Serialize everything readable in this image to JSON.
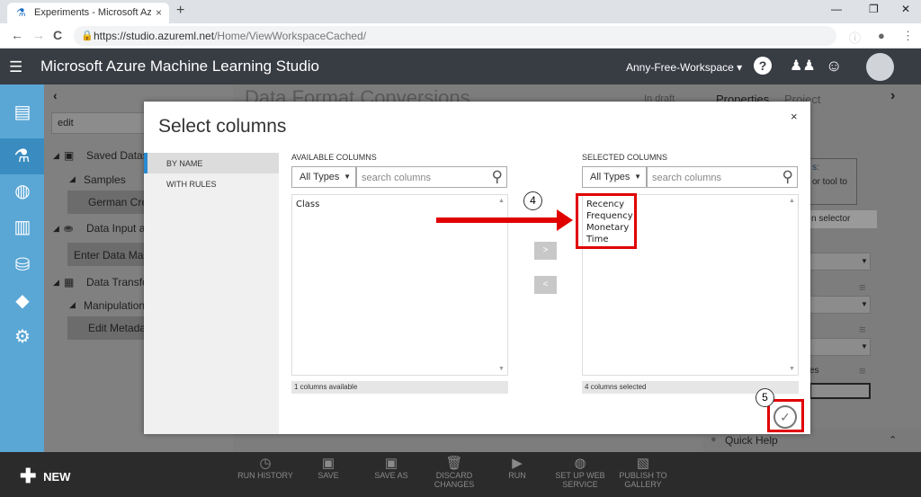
{
  "browser": {
    "tab_title": "Experiments - Microsoft Azure",
    "tab_close": "×",
    "new_tab": "+",
    "url_host": "https://studio.azureml.net",
    "url_path": "/Home/ViewWorkspaceCached/",
    "back": "←",
    "forward": "→",
    "reload": "C",
    "min": "—",
    "max": "❐",
    "close": "✕"
  },
  "app": {
    "title": "Microsoft Azure Machine Learning Studio",
    "workspace": "Anny-Free-Workspace ▾",
    "help": "?"
  },
  "background": {
    "search_value": "edit",
    "tree": {
      "saved_datasets": "Saved Datas",
      "samples": "Samples",
      "german_credit": "German Cre",
      "data_input": "Data Input a",
      "enter_data": "Enter Data Mar",
      "data_transform": "Data Transfo",
      "manipulation": "Manipulation",
      "edit_metadata": "Edit Metada"
    },
    "experiment_title": "Data Format Conversions",
    "draft_status": "In draft",
    "properties_tab": "Properties",
    "project_tab": "Project",
    "right_partial_1": "s:",
    "right_partial_2": "or tool to",
    "column_selector": "n selector",
    "partial_es": "es",
    "quick_help": "Quick Help",
    "collapse_left": "‹",
    "collapse_right": "›",
    "chevron_up": "⌃"
  },
  "footer": {
    "new_label": "NEW",
    "buttons": [
      "RUN HISTORY",
      "SAVE",
      "SAVE AS",
      "DISCARD CHANGES",
      "RUN",
      "SET UP WEB SERVICE",
      "PUBLISH TO GALLERY"
    ]
  },
  "modal": {
    "title": "Select columns",
    "close": "×",
    "nav": [
      "BY NAME",
      "WITH RULES"
    ],
    "available": {
      "header": "AVAILABLE COLUMNS",
      "type_filter": "All Types",
      "search_placeholder": "search columns",
      "items": [
        "Class"
      ],
      "status": "1 columns available"
    },
    "selected": {
      "header": "SELECTED COLUMNS",
      "type_filter": "All Types",
      "search_placeholder": "search columns",
      "items": [
        "Recency",
        "Frequency",
        "Monetary",
        "Time"
      ],
      "status": "4 columns selected"
    },
    "move_right": ">",
    "move_left": "<",
    "ok": "✓"
  },
  "annotations": {
    "step_4": "4",
    "step_5": "5"
  },
  "colors": {
    "accent": "#2a8ad0",
    "rail": "#5aa7d6",
    "header": "#383c43",
    "highlight_red": "#e00000"
  }
}
